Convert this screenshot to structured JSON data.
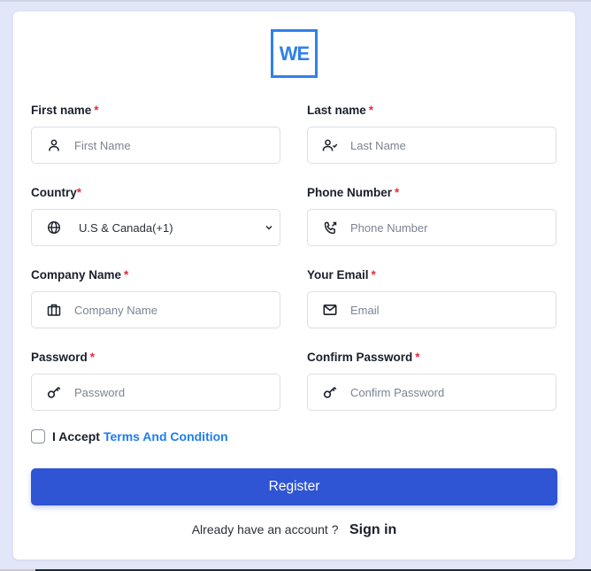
{
  "logo": {
    "text": "WE",
    "color": "#2f80ed"
  },
  "form": {
    "fields": [
      {
        "id": "first-name",
        "label": "First name",
        "required_mark": "*",
        "placeholder": "First Name",
        "icon": "user-icon"
      },
      {
        "id": "last-name",
        "label": "Last name",
        "required_mark": "*",
        "placeholder": "Last Name",
        "icon": "user-check-icon"
      },
      {
        "id": "country",
        "label": "Country",
        "required_mark": "*",
        "selected_value": "U.S & Canada(+1)",
        "icon": "globe-icon",
        "type": "select"
      },
      {
        "id": "phone",
        "label": "Phone Number",
        "required_mark": "*",
        "placeholder": "Phone Number",
        "icon": "phone-outgoing-icon"
      },
      {
        "id": "company",
        "label": "Company Name",
        "required_mark": "*",
        "placeholder": "Company Name",
        "icon": "briefcase-icon"
      },
      {
        "id": "email",
        "label": "Your Email",
        "required_mark": "*",
        "placeholder": "Email",
        "icon": "mail-icon"
      },
      {
        "id": "password",
        "label": "Password",
        "required_mark": "*",
        "placeholder": "Password",
        "icon": "key-icon"
      },
      {
        "id": "confirm-password",
        "label": "Confirm Password",
        "required_mark": "*",
        "placeholder": "Confirm Password",
        "icon": "key-icon"
      }
    ],
    "terms": {
      "prefix": "I Accept",
      "link": "Terms And Condition",
      "checked": false
    },
    "register_label": "Register",
    "signin_prompt": "Already have an account ?",
    "signin_link": "Sign in"
  },
  "colors": {
    "background": "#e1e6f8",
    "primary_button": "#2f55d4",
    "link": "#1e7df0",
    "required": "#e02e3f"
  }
}
